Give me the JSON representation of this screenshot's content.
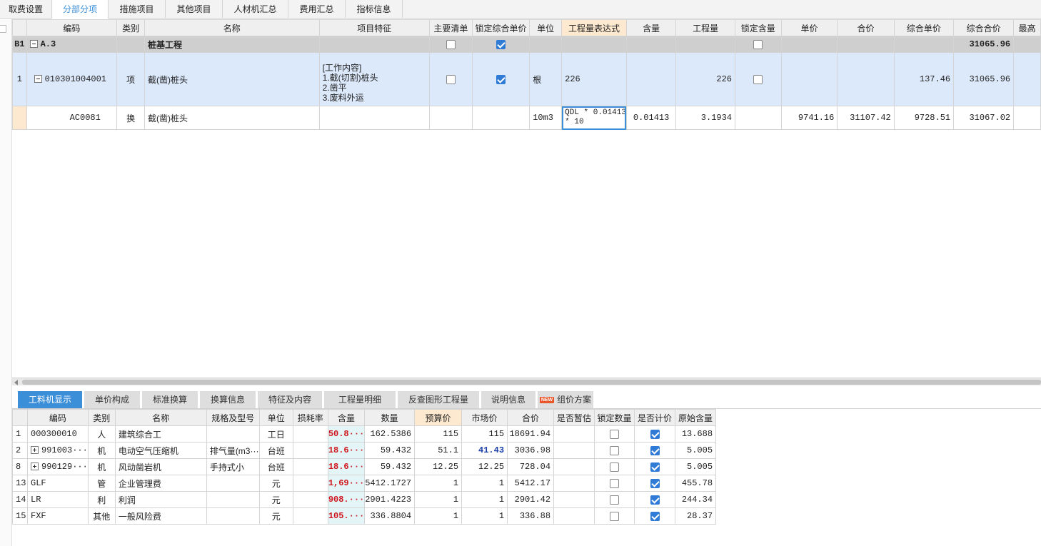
{
  "top_tabs": [
    {
      "label": "取费设置",
      "active": false
    },
    {
      "label": "分部分项",
      "active": true
    },
    {
      "label": "措施项目",
      "active": false
    },
    {
      "label": "其他项目",
      "active": false
    },
    {
      "label": "人材机汇总",
      "active": false
    },
    {
      "label": "费用汇总",
      "active": false
    },
    {
      "label": "指标信息",
      "active": false
    }
  ],
  "upper_grid": {
    "columns": [
      "编码",
      "类别",
      "名称",
      "项目特征",
      "主要清单",
      "锁定综合单价",
      "单位",
      "工程量表达式",
      "含量",
      "工程量",
      "锁定含量",
      "单价",
      "合价",
      "综合单价",
      "综合合价",
      "最高"
    ],
    "highlight_column": "工程量表达式",
    "rows": [
      {
        "index": "B1",
        "code": "A.3",
        "type": "",
        "name": "桩基工程",
        "features": [],
        "main_list": false,
        "lock_price": true,
        "unit": "",
        "expr": "",
        "content": "",
        "quantity": "",
        "lock_content": false,
        "unit_price": "",
        "total": "",
        "comp_price": "",
        "comp_total": "31065.96"
      },
      {
        "index": "1",
        "code": "010301004001",
        "type": "项",
        "name": "截(凿)桩头",
        "features": [
          "[工作内容]",
          "1.截(切割)桩头",
          "2.凿平",
          "3.废料外运"
        ],
        "main_list": false,
        "lock_price": true,
        "unit": "根",
        "expr": "226",
        "content": "",
        "quantity": "226",
        "lock_content": false,
        "unit_price": "",
        "total": "",
        "comp_price": "137.46",
        "comp_total": "31065.96"
      },
      {
        "index": "",
        "code": "AC0081",
        "type": "换",
        "name": "截(凿)桩头",
        "features": [],
        "unit": "10m3",
        "expr_line1": "QDL * 0.01413",
        "expr_line2": "* 10",
        "content": "0.01413",
        "quantity": "3.1934",
        "unit_price": "9741.16",
        "total": "31107.42",
        "comp_price": "9728.51",
        "comp_total": "31067.02"
      }
    ]
  },
  "bottom_tabs": [
    {
      "label": "工料机显示",
      "active": true
    },
    {
      "label": "单价构成",
      "active": false
    },
    {
      "label": "标准换算",
      "active": false
    },
    {
      "label": "换算信息",
      "active": false
    },
    {
      "label": "特征及内容",
      "active": false
    },
    {
      "label": "工程量明细",
      "active": false
    },
    {
      "label": "反查图形工程量",
      "active": false
    },
    {
      "label": "说明信息",
      "active": false
    },
    {
      "label": "组价方案",
      "active": false,
      "badge": "NEW"
    }
  ],
  "lower_grid": {
    "columns": [
      "编码",
      "类别",
      "名称",
      "规格及型号",
      "单位",
      "损耗率",
      "含量",
      "数量",
      "预算价",
      "市场价",
      "合价",
      "是否暂估",
      "锁定数量",
      "是否计价",
      "原始含量"
    ],
    "highlight_column": "预算价",
    "rows": [
      {
        "index": "1",
        "expand": false,
        "code": "000300010",
        "type": "人",
        "name": "建筑综合工",
        "spec": "",
        "unit": "工日",
        "loss": "",
        "content": "50.8···",
        "qty": "162.5386",
        "budget": "115",
        "market": "115",
        "market_blue": false,
        "total": "18691.94",
        "lock_qty": false,
        "priced": true,
        "orig": "13.688"
      },
      {
        "index": "2",
        "expand": true,
        "code": "991003···",
        "type": "机",
        "name": "电动空气压缩机",
        "spec": "排气量(m3···",
        "unit": "台班",
        "loss": "",
        "content": "18.6···",
        "qty": "59.432",
        "budget": "51.1",
        "market": "41.43",
        "market_blue": true,
        "total": "3036.98",
        "lock_qty": false,
        "priced": true,
        "orig": "5.005"
      },
      {
        "index": "8",
        "expand": true,
        "code": "990129···",
        "type": "机",
        "name": "风动凿岩机",
        "spec": "手持式小",
        "unit": "台班",
        "loss": "",
        "content": "18.6···",
        "qty": "59.432",
        "budget": "12.25",
        "market": "12.25",
        "market_blue": false,
        "total": "728.04",
        "lock_qty": false,
        "priced": true,
        "orig": "5.005"
      },
      {
        "index": "13",
        "expand": false,
        "code": "GLF",
        "type": "管",
        "name": "企业管理费",
        "spec": "",
        "unit": "元",
        "loss": "",
        "content": "1,69···",
        "qty": "5412.1727",
        "budget": "1",
        "market": "1",
        "market_blue": false,
        "total": "5412.17",
        "lock_qty": false,
        "priced": true,
        "orig": "455.78"
      },
      {
        "index": "14",
        "expand": false,
        "code": "LR",
        "type": "利",
        "name": "利润",
        "spec": "",
        "unit": "元",
        "loss": "",
        "content": "908.···",
        "qty": "2901.4223",
        "budget": "1",
        "market": "1",
        "market_blue": false,
        "total": "2901.42",
        "lock_qty": false,
        "priced": true,
        "orig": "244.34"
      },
      {
        "index": "15",
        "expand": false,
        "code": "FXF",
        "type": "其他",
        "name": "一般风险费",
        "spec": "",
        "unit": "元",
        "loss": "",
        "content": "105.···",
        "qty": "336.8804",
        "budget": "1",
        "market": "1",
        "market_blue": false,
        "total": "336.88",
        "lock_qty": false,
        "priced": true,
        "orig": "28.37"
      }
    ]
  }
}
